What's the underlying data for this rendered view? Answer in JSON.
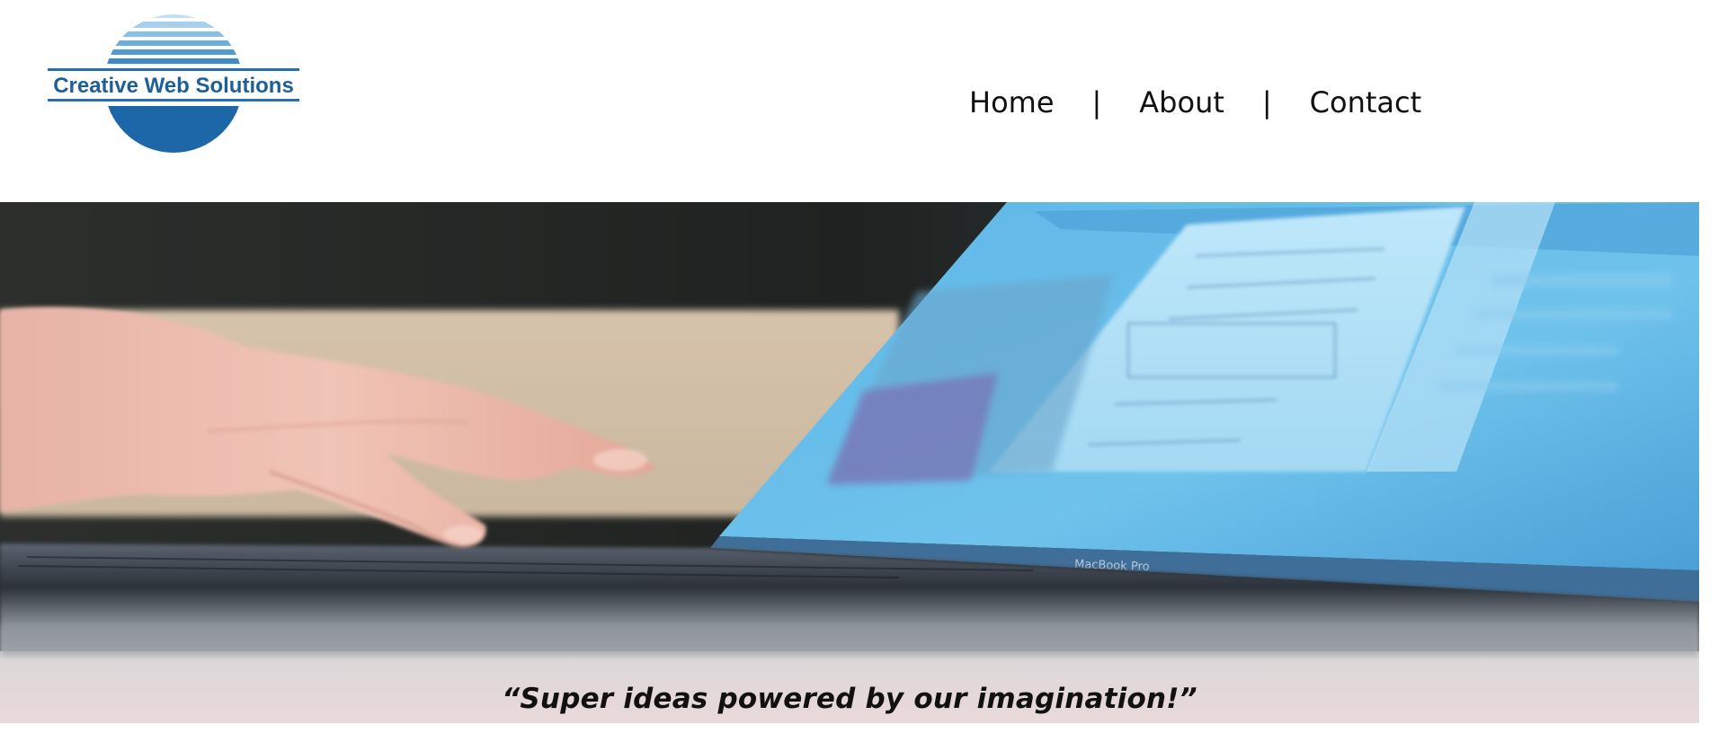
{
  "logo": {
    "text": "Creative Web Solutions",
    "colors": {
      "light": "#9ccbea",
      "mid": "#4c93cb",
      "dark": "#1e6aa9",
      "text": "#1f5f97"
    }
  },
  "nav": {
    "items": [
      {
        "label": "Home"
      },
      {
        "label": "About"
      },
      {
        "label": "Contact"
      }
    ],
    "separator": "|"
  },
  "hero": {
    "image": "laptop-typing-photo",
    "tagline": "“Super ideas powered by our imagination!”"
  }
}
